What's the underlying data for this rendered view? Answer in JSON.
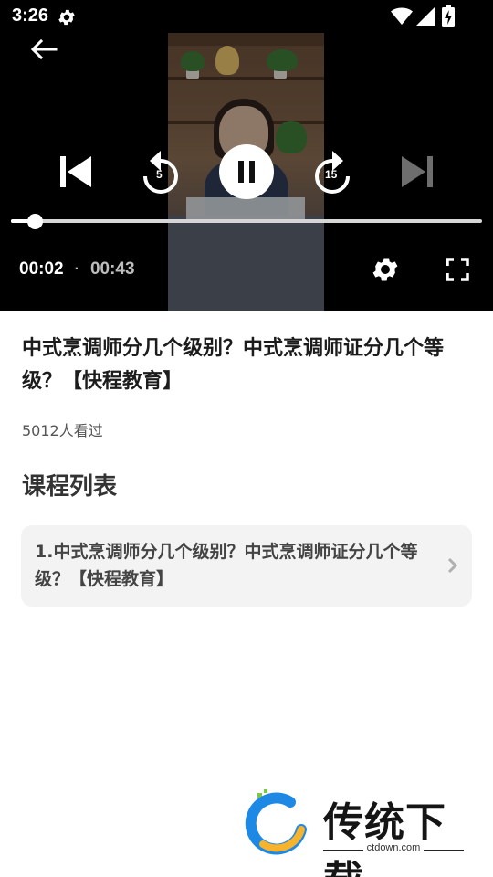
{
  "status_bar": {
    "time": "3:26",
    "icons": [
      "settings-icon",
      "wifi-icon",
      "signal-icon",
      "battery-charging-icon"
    ]
  },
  "player": {
    "back_icon": "arrow-left-icon",
    "prev_icon": "skip-previous-icon",
    "rewind_seconds": "5",
    "play_state_icon": "pause-icon",
    "forward_seconds": "15",
    "next_icon": "skip-next-icon",
    "current_time": "00:02",
    "separator": "·",
    "total_time": "00:43",
    "progress_fraction": 0.05,
    "settings_icon": "gear-icon",
    "fullscreen_icon": "fullscreen-icon"
  },
  "video": {
    "title": "中式烹调师分几个级别？中式烹调师证分几个等级？【快程教育】",
    "views": "5012人看过"
  },
  "course_list": {
    "heading": "课程列表",
    "items": [
      {
        "label": "1.中式烹调师分几个级别？中式烹调师证分几个等级？【快程教育】"
      }
    ]
  },
  "watermark": {
    "text": "传统下载",
    "url": "ctdown.com"
  },
  "colors": {
    "player_bg": "#000000",
    "card_bg": "#f3f3f3",
    "title_text": "#1c1c1c"
  }
}
